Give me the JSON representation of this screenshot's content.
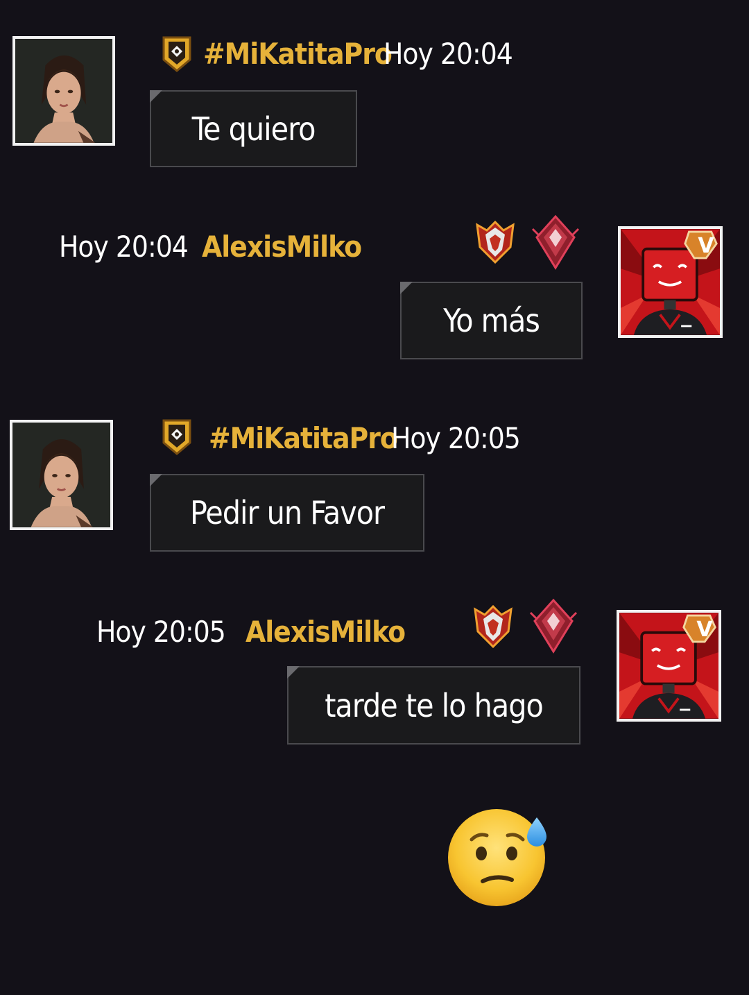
{
  "messages": [
    {
      "sender": "#MiKatitaPro",
      "time": "Hoy 20:04",
      "text": "Te quiero",
      "side": "left"
    },
    {
      "sender": "AlexisMilko",
      "time": "Hoy 20:04",
      "text": "Yo más",
      "side": "right",
      "avatar_badge": "V"
    },
    {
      "sender": "#MiKatitaPro",
      "time": "Hoy 20:05",
      "text": "Pedir un Favor",
      "side": "left"
    },
    {
      "sender": "AlexisMilko",
      "time": "Hoy 20:05",
      "text": "tarde te lo hago",
      "side": "right",
      "avatar_badge": "V"
    }
  ],
  "reaction_emoji": "😥",
  "icons": {
    "guild_badge": "guild-shield-icon",
    "rank_badge": "heroic-rank-icon",
    "elite_badge": "elite-diamond-icon",
    "emoji": "anxious-face-with-sweat-icon"
  },
  "colors": {
    "background": "#131118",
    "sender_name": "#e6b23a",
    "bubble": "#1a1a1c",
    "bubble_border": "#4a4a4e"
  }
}
